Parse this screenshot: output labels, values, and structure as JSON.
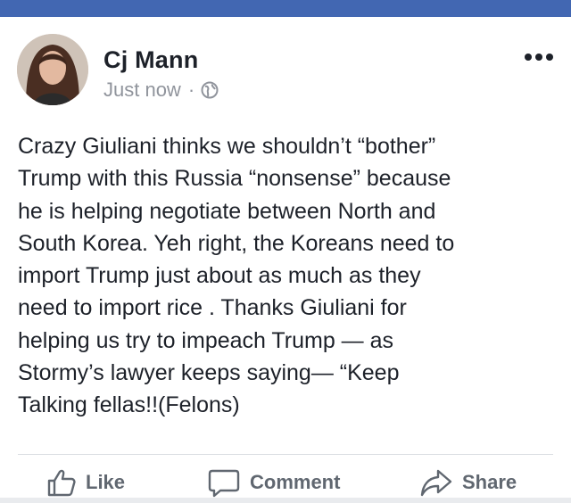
{
  "post": {
    "author": "Cj Mann",
    "timestamp": "Just now",
    "separator": "·",
    "audience_icon": "globe-icon",
    "menu_icon": "more-options-icon",
    "text": "Crazy Giuliani thinks we shouldn’t “bother”\nTrump with this Russia “nonsense” because\nhe is helping negotiate between North and\nSouth Korea. Yeh right, the Koreans need to\nimport Trump just about as much as they\nneed to import rice . Thanks Giuliani for\nhelping us try to impeach Trump — as\nStormy’s lawyer keeps saying— “Keep\nTalking fellas!!(Felons)"
  },
  "actions": {
    "like_label": "Like",
    "comment_label": "Comment",
    "share_label": "Share"
  },
  "colors": {
    "brand_bar": "#4267b2",
    "text_primary": "#1d2129",
    "text_secondary": "#90949c",
    "action_gray": "#606770"
  }
}
